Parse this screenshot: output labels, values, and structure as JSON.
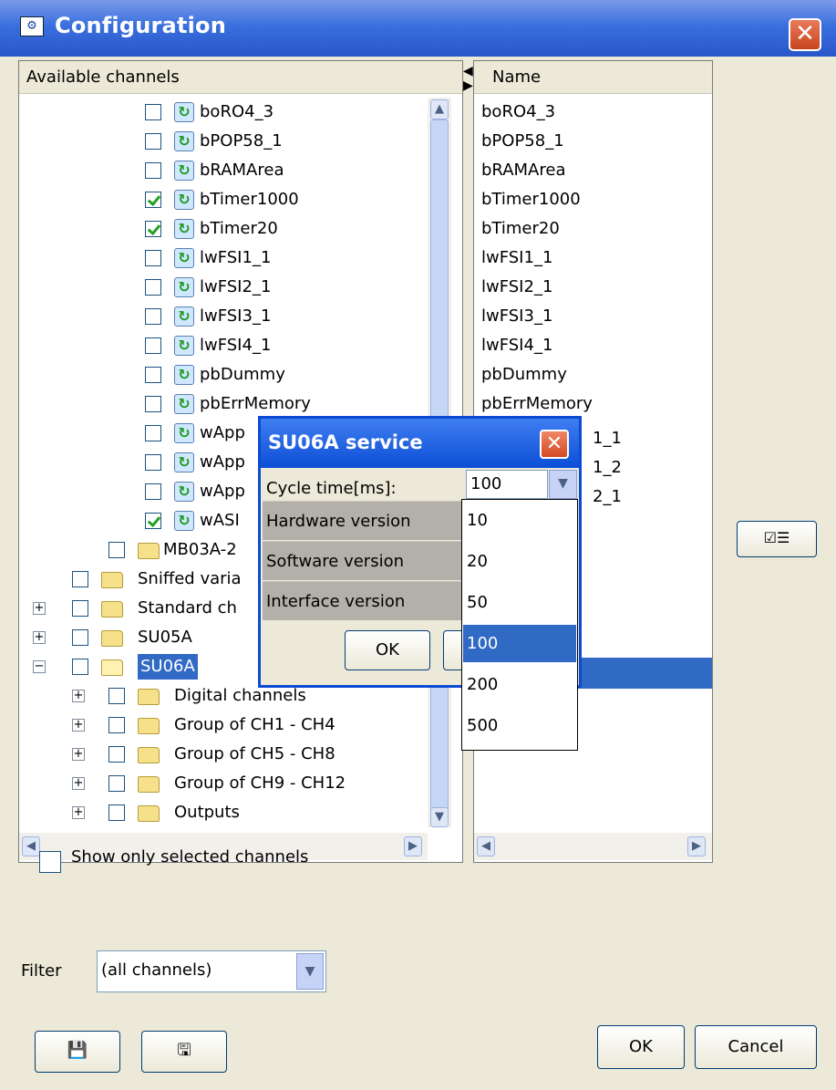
{
  "window": {
    "title": "Configuration"
  },
  "left_panel": {
    "header": "Available channels",
    "variables": [
      {
        "label": "boRO4_3",
        "checked": false
      },
      {
        "label": "bPOP58_1",
        "checked": false
      },
      {
        "label": "bRAMArea",
        "checked": false
      },
      {
        "label": "bTimer1000",
        "checked": true
      },
      {
        "label": "bTimer20",
        "checked": true
      },
      {
        "label": "lwFSI1_1",
        "checked": false
      },
      {
        "label": "lwFSI2_1",
        "checked": false
      },
      {
        "label": "lwFSI3_1",
        "checked": false
      },
      {
        "label": "lwFSI4_1",
        "checked": false
      },
      {
        "label": "pbDummy",
        "checked": false
      },
      {
        "label": "pbErrMemory",
        "checked": false
      },
      {
        "label": "wApp",
        "checked": false
      },
      {
        "label": "wApp",
        "checked": false
      },
      {
        "label": "wApp",
        "checked": false
      },
      {
        "label": "wASI",
        "checked": true
      }
    ],
    "folders": [
      {
        "label": "MB03A-2",
        "expander": ""
      },
      {
        "label": "Sniffed varia",
        "expander": ""
      },
      {
        "label": "Standard ch",
        "expander": "+"
      },
      {
        "label": "SU05A",
        "expander": "+"
      },
      {
        "label": "SU06A",
        "expander": "−"
      }
    ],
    "su06a_children": [
      {
        "label": "Digital channels",
        "expander": "+"
      },
      {
        "label": "Group of CH1 - CH4",
        "expander": "+"
      },
      {
        "label": "Group of CH5 - CH8",
        "expander": "+"
      },
      {
        "label": "Group of CH9 - CH12",
        "expander": "+"
      },
      {
        "label": "Outputs",
        "expander": "+"
      }
    ]
  },
  "right_panel": {
    "header": "Name",
    "items": [
      "boRO4_3",
      "bPOP58_1",
      "bRAMArea",
      "bTimer1000",
      "bTimer20",
      "lwFSI1_1",
      "lwFSI2_1",
      "lwFSI3_1",
      "lwFSI4_1",
      "pbDummy",
      "pbErrMemory",
      "1_1",
      "1_2",
      "2_1"
    ]
  },
  "popup": {
    "title": "SU06A service",
    "cycle_label": "Cycle time[ms]:",
    "cycle_value": "100",
    "rows": [
      "Hardware version",
      "Software version",
      "Interface version"
    ],
    "ok": "OK"
  },
  "dropdown": {
    "options": [
      "10",
      "20",
      "50",
      "100",
      "200",
      "500"
    ],
    "selected": "100"
  },
  "bottom": {
    "show_selected_label": "Show only selected channels",
    "filter_label": "Filter",
    "filter_value": "(all channels)",
    "ok": "OK",
    "cancel": "Cancel"
  },
  "icons": {
    "app": "rolex-logo-icon",
    "save": "floppy-disk-icon",
    "save_as": "floppy-disks-icon",
    "select_all": "checklist-icon"
  },
  "colors": {
    "title_bar": "#2956c9",
    "selection": "#316ac5",
    "window_bg": "#ECE9D8"
  }
}
